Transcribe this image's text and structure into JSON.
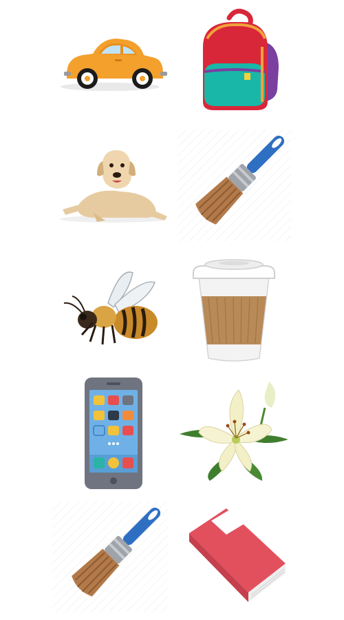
{
  "items": [
    {
      "name": "car",
      "icon": "car-icon",
      "color": "#F3A02D"
    },
    {
      "name": "backpack",
      "icon": "backpack-icon",
      "color": "#D9273A"
    },
    {
      "name": "dog",
      "icon": "dog-icon",
      "color": "#E7CBA0"
    },
    {
      "name": "paintbrush",
      "icon": "paintbrush-icon",
      "color": "#2F6FC3"
    },
    {
      "name": "bee",
      "icon": "bee-icon",
      "color": "#C98A2A"
    },
    {
      "name": "coffee-cup",
      "icon": "coffee-cup-icon",
      "color": "#B88A57"
    },
    {
      "name": "smartphone",
      "icon": "smartphone-icon",
      "color": "#6F7480"
    },
    {
      "name": "lily",
      "icon": "lily-icon",
      "color": "#F3F0C8"
    },
    {
      "name": "paintbrush",
      "icon": "paintbrush-icon",
      "color": "#2F6FC3"
    },
    {
      "name": "book",
      "icon": "book-icon",
      "color": "#E2505E"
    }
  ]
}
